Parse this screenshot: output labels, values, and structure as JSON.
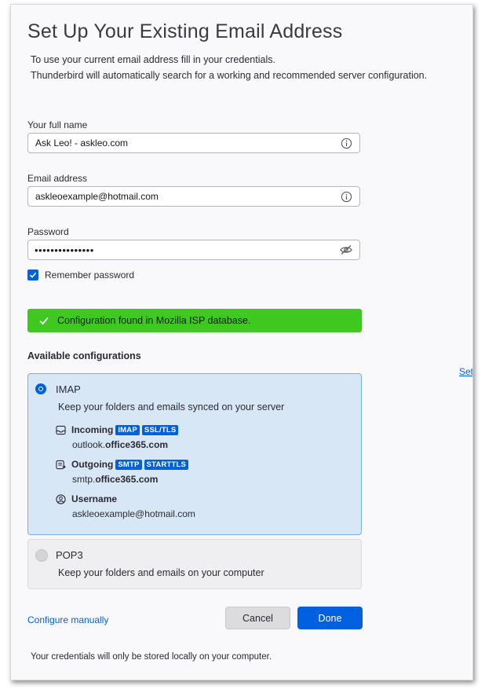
{
  "header": {
    "title": "Set Up Your Existing Email Address",
    "subtitle_line1": "To use your current email address fill in your credentials.",
    "subtitle_line2": "Thunderbird will automatically search for a working and recommended server configuration."
  },
  "form": {
    "full_name": {
      "label": "Your full name",
      "value": "Ask Leo! - askleo.com",
      "icon": "info-icon"
    },
    "email": {
      "label": "Email address",
      "value": "askleoexample@hotmail.com",
      "icon": "info-icon"
    },
    "password": {
      "label": "Password",
      "value": "•••••••••••••••",
      "icon": "eye-slash-icon"
    },
    "remember": {
      "label": "Remember password",
      "checked": true
    }
  },
  "status": {
    "message": "Configuration found in Mozilla ISP database.",
    "icon": "checkmark-icon",
    "color": "#3fc81f"
  },
  "configs": {
    "title": "Available configurations",
    "side_link": "Set",
    "imap": {
      "name": "IMAP",
      "selected": true,
      "description": "Keep your folders and emails synced on your server",
      "incoming": {
        "label": "Incoming",
        "badges": [
          "IMAP",
          "SSL/TLS"
        ],
        "host_prefix": "outlook.",
        "host_domain": "office365.com"
      },
      "outgoing": {
        "label": "Outgoing",
        "badges": [
          "SMTP",
          "STARTTLS"
        ],
        "host_prefix": "smtp.",
        "host_domain": "office365.com"
      },
      "username": {
        "label": "Username",
        "value": "askleoexample@hotmail.com"
      }
    },
    "pop3": {
      "name": "POP3",
      "selected": false,
      "description": "Keep your folders and emails on your computer"
    }
  },
  "actions": {
    "configure_manually": "Configure manually",
    "cancel": "Cancel",
    "done": "Done"
  },
  "footer": {
    "note": "Your credentials will only be stored locally on your computer."
  },
  "colors": {
    "accent": "#0061e0",
    "success": "#3fc81f",
    "selected_card": "#d8e7f6"
  }
}
